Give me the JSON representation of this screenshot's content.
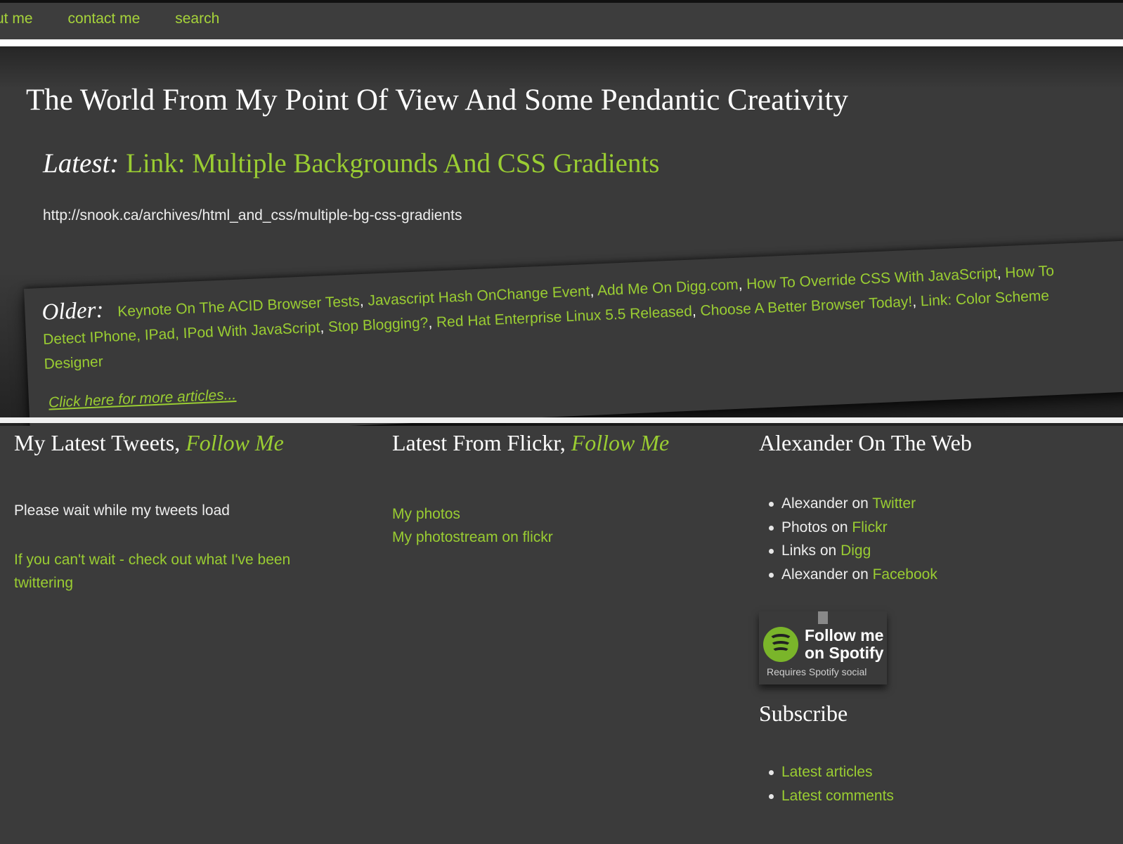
{
  "nav": {
    "items": [
      "ut me",
      "contact me",
      "search"
    ]
  },
  "hero": {
    "site_title": "The World From My Point Of View And Some Pendantic Creativity",
    "latest_label": "Latest:",
    "latest_link": "Link: Multiple Backgrounds And CSS Gradients",
    "latest_url": "http://snook.ca/archives/html_and_css/multiple-bg-css-gradients",
    "older_label": "Older:",
    "older_links": [
      "Keynote On The ACID Browser Tests",
      "Javascript Hash OnChange Event",
      "Add Me On Digg.com",
      "How To Override CSS With JavaScript",
      "How To Detect IPhone, IPad, IPod With JavaScript",
      "Stop Blogging?",
      "Red Hat Enterprise Linux 5.5 Released",
      "Choose A Better Browser Today!",
      "Link: Color Scheme Designer"
    ],
    "separator": ", ",
    "more_articles": "Click here for more articles..."
  },
  "tweets": {
    "title": "My Latest Tweets, ",
    "follow": "Follow Me",
    "wait_text": "Please wait while my tweets load",
    "fallback_link": "If you can't wait - check out what I've been twittering"
  },
  "flickr": {
    "title": "Latest From Flickr, ",
    "follow": "Follow Me",
    "links": [
      "My photos",
      "My photostream on flickr"
    ]
  },
  "web": {
    "title": "Alexander On The Web",
    "items": [
      {
        "prefix": "Alexander on ",
        "link": "Twitter"
      },
      {
        "prefix": "Photos on ",
        "link": "Flickr"
      },
      {
        "prefix": "Links on ",
        "link": "Digg"
      },
      {
        "prefix": "Alexander on ",
        "link": "Facebook"
      }
    ]
  },
  "spotify": {
    "follow_text": "Follow me\non Spotify",
    "requires": "Requires Spotify social"
  },
  "subscribe": {
    "title": "Subscribe",
    "items": [
      "Latest articles",
      "Latest comments"
    ]
  },
  "colors": {
    "accent": "#9acd32",
    "background": "#3b3b3b",
    "text": "#e6e6e6"
  }
}
